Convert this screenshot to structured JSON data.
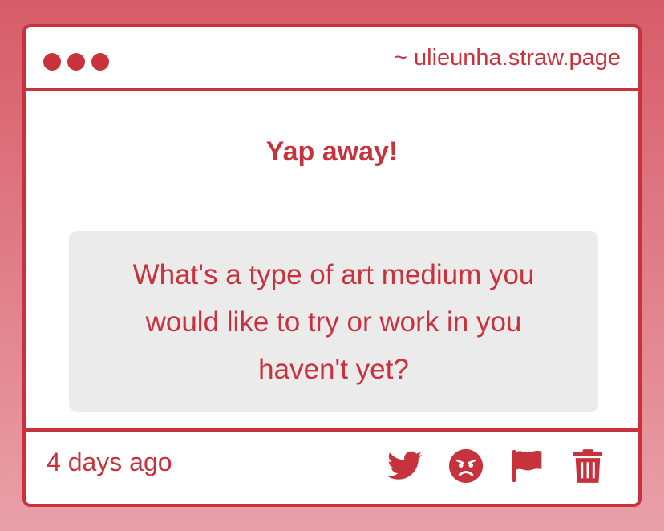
{
  "header": {
    "url": "~ ulieunha.straw.page"
  },
  "main": {
    "title": "Yap away!",
    "question": "What's a type of art medium you would like to try or work in you haven't yet?"
  },
  "footer": {
    "time": "4 days ago",
    "icons": [
      "twitter-icon",
      "angry-face-icon",
      "flag-icon",
      "trash-icon"
    ]
  },
  "colors": {
    "accent": "#c8323c",
    "background_top": "#d75c69",
    "background_bottom": "#e9a0a8",
    "card": "#ffffff",
    "question_bg": "#ecebeb"
  }
}
